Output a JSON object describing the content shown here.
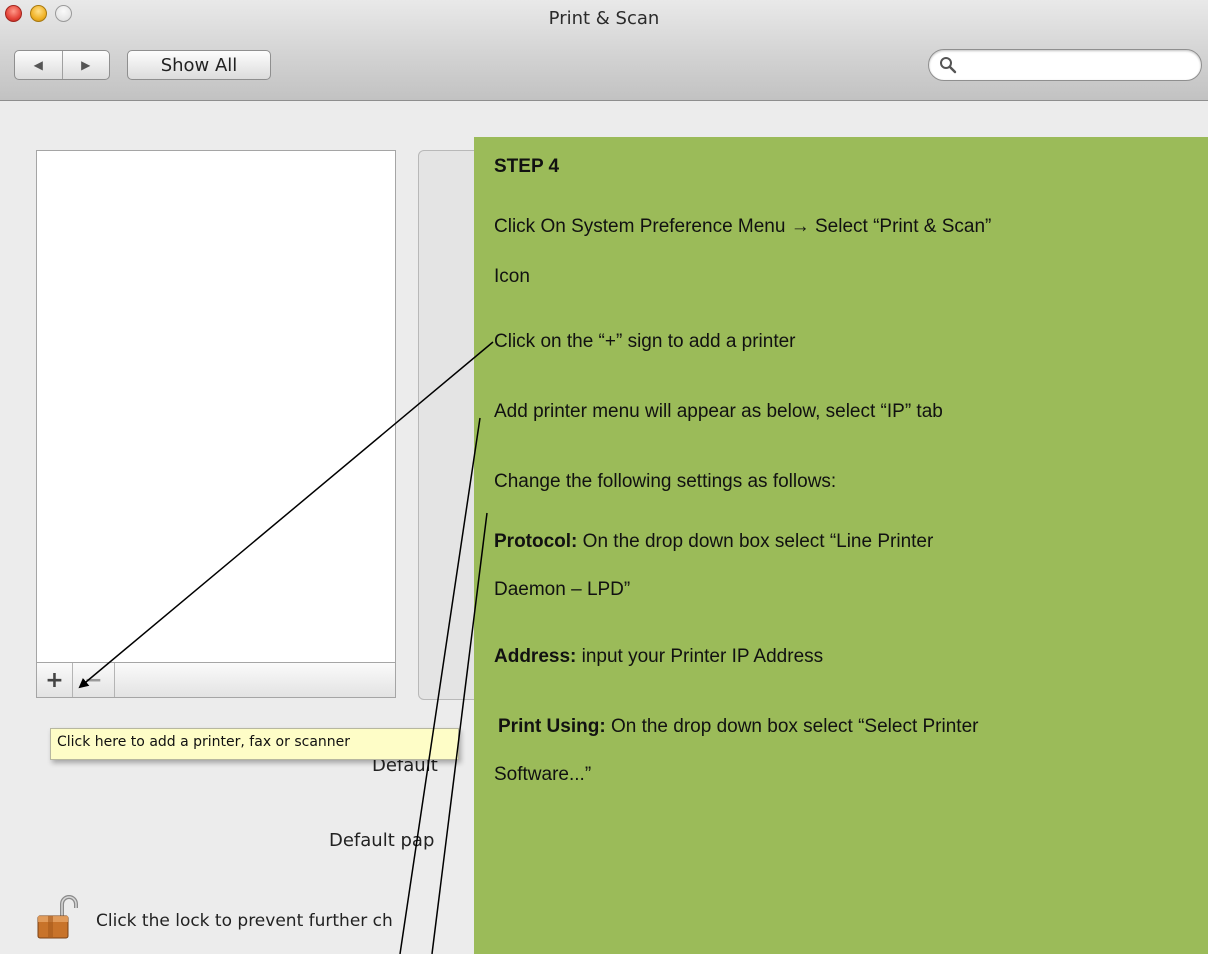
{
  "window": {
    "title": "Print & Scan",
    "traffic_lights": [
      "close",
      "minimize",
      "zoom"
    ],
    "nav": {
      "back_icon": "◀",
      "forward_icon": "▶"
    },
    "show_all_label": "Show All",
    "search": {
      "value": "",
      "placeholder": ""
    }
  },
  "printer_list": {
    "items": [],
    "add_label": "+",
    "remove_label": "−"
  },
  "tooltip": "Click here to add a printer, fax or scanner",
  "settings": {
    "default_printer_label": "Default",
    "default_paper_label": "Default pap"
  },
  "lock": {
    "text": "Click the lock to prevent further ch"
  },
  "instructions": {
    "title": "STEP  4",
    "step1_line1": "Click On System Preference Menu → Select “Print & Scan”",
    "step1_line2": "Icon",
    "step2": "Click on the “+” sign to add a printer",
    "step3": "Add printer menu will appear as below, select “IP” tab",
    "step4": "Change the following settings as follows:",
    "protocol_label": "Protocol:",
    "protocol_text": " On the drop down box select “Line Printer",
    "protocol_text2": "Daemon – LPD”",
    "address_label": "Address:",
    "address_text": " input your Printer IP Address",
    "print_using_label": "Print Using:",
    "print_using_text": " On the drop down box select “Select Printer",
    "print_using_text2": "Software...”"
  },
  "colors": {
    "overlay_background": "#9bbb59",
    "tooltip_background": "#fefdc7",
    "window_background": "#ececec"
  }
}
